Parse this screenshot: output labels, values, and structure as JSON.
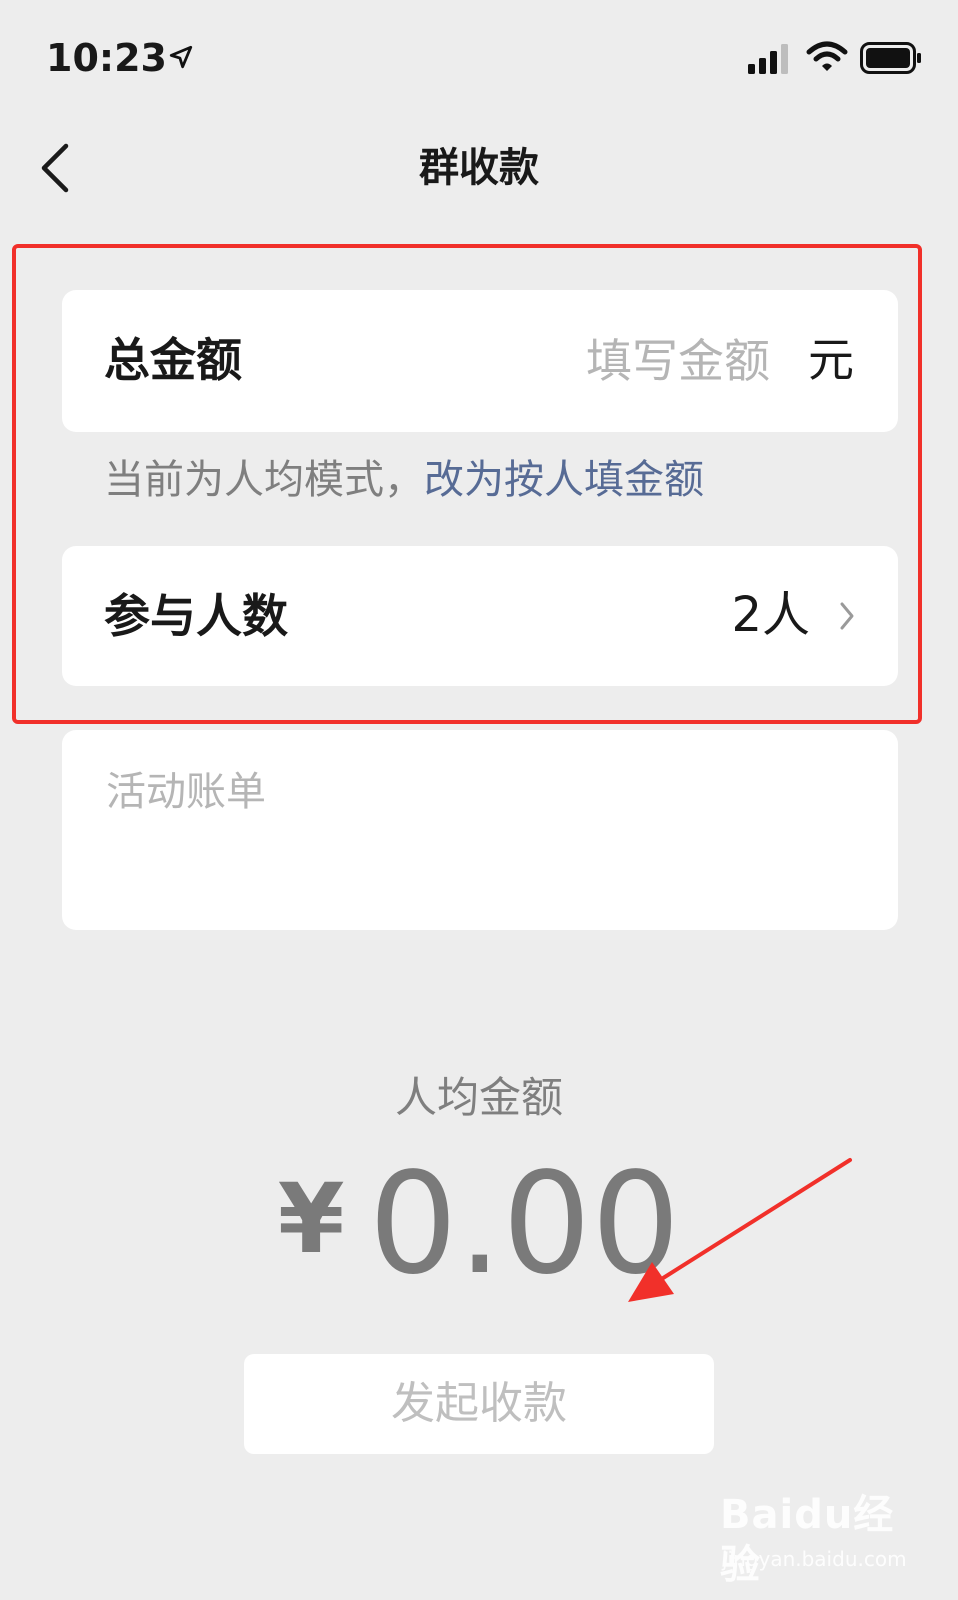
{
  "status_bar": {
    "time": "10:23",
    "icons": [
      "location-arrow-icon",
      "cellular-signal-icon",
      "wifi-icon",
      "battery-icon"
    ]
  },
  "nav": {
    "title": "群收款",
    "back_icon": "chevron-left-icon"
  },
  "form": {
    "total": {
      "label": "总金额",
      "placeholder": "填写金额",
      "value": "",
      "unit": "元"
    },
    "mode": {
      "text": "当前为人均模式，",
      "link": "改为按人填金额"
    },
    "participants": {
      "label": "参与人数",
      "value": "2人",
      "icon": "chevron-right-icon"
    },
    "bill": {
      "placeholder": "活动账单"
    }
  },
  "summary": {
    "label": "人均金额",
    "currency": "¥",
    "amount": "0.00"
  },
  "submit_label": "发起收款",
  "watermark": {
    "main": "Baidu经验",
    "sub": "jingyan.baidu.com"
  },
  "colors": {
    "background": "#ededed",
    "card": "#ffffff",
    "link": "#576b95",
    "annotation": "#f1302a",
    "muted": "#7f7f7f",
    "placeholder": "#b5b5b5"
  }
}
